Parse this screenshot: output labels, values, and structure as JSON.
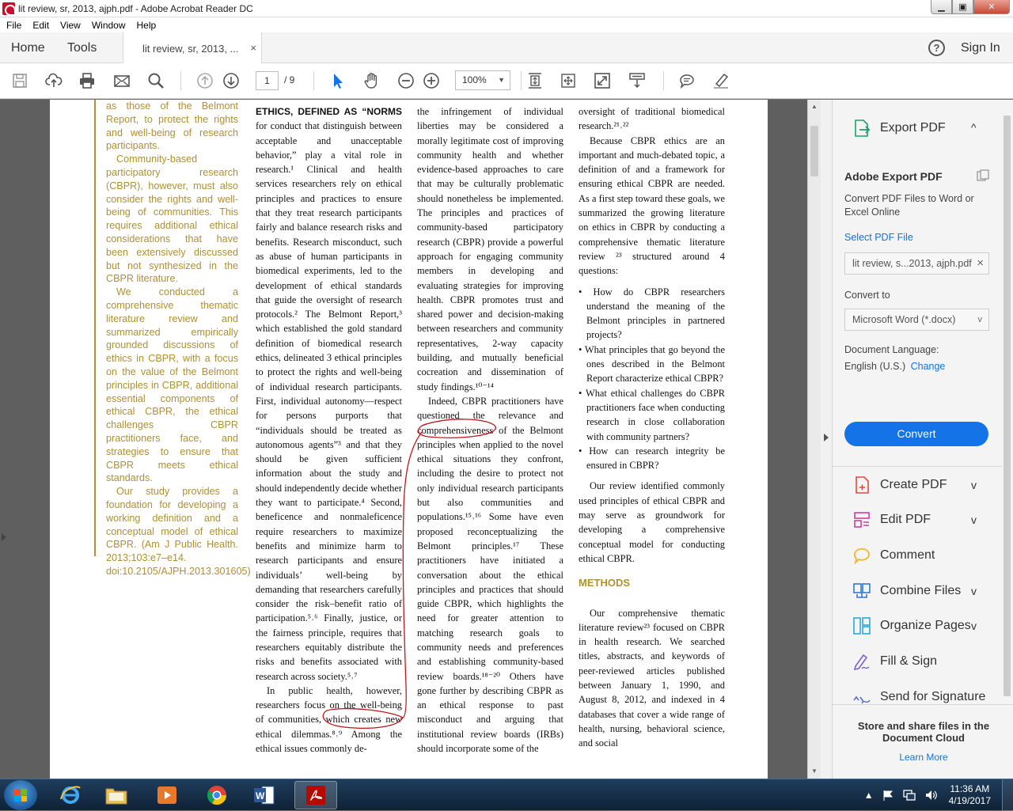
{
  "window": {
    "title": "lit review, sr, 2013, ajph.pdf - Adobe Acrobat Reader DC",
    "min": "▁",
    "max": "▣",
    "close": "✕"
  },
  "menu": [
    "File",
    "Edit",
    "View",
    "Window",
    "Help"
  ],
  "tabs": {
    "home": "Home",
    "tools": "Tools",
    "document": "lit review, sr, 2013, ...",
    "close": "×",
    "help": "?",
    "sign_in": "Sign In"
  },
  "toolbar": {
    "page_current": "1",
    "page_total": "/ 9",
    "zoom": "100%",
    "zoom_caret": "▼",
    "icons": [
      "save-icon",
      "upload-icon",
      "print-icon",
      "email-icon",
      "search-icon",
      "page-up-icon",
      "page-down-icon",
      "select-cursor-icon",
      "hand-icon",
      "zoom-out-icon",
      "zoom-in-icon",
      "fit-page-icon",
      "full-screen-icon",
      "read-mode-icon",
      "scroll-mode-icon",
      "comment-icon",
      "highlight-pen-icon"
    ]
  },
  "document": {
    "abstract": [
      "as those of the Belmont Report, to protect the rights and well-being of research participants.",
      "Community-based participatory research (CBPR), however, must also consider the rights and well-being of communities. This requires additional ethical considerations that have been extensively discussed but not synthesized in the CBPR literature.",
      "We conducted a comprehensive thematic literature review and summarized empirically grounded discussions of ethics in CBPR, with a focus on the value of the Belmont principles in CBPR, additional essential components of ethical CBPR, the ethical challenges CBPR practitioners face, and strategies to ensure that CBPR meets ethical standards.",
      "Our study provides a foundation for developing a working definition and a conceptual model of ethical CBPR. (Am J Public Health. 2013;103:e7–e14. doi:10.2105/AJPH.2013.301605)"
    ],
    "col1": {
      "heading": "ETHICS, DEFINED AS “NORMS",
      "p1": "for conduct that distinguish between acceptable and unacceptable behavior,” play a vital role in research.¹ Clinical and health services researchers rely on ethical principles and practices to ensure that they treat research participants fairly and balance research risks and benefits. Research misconduct, such as abuse of human participants in biomedical experiments, led to the development of ethical standards that guide the oversight of research protocols.² The Belmont Report,³ which established the gold standard definition of biomedical research ethics, delineated 3 ethical principles to protect the rights and well-being of individual research participants. First, individual autonomy—respect for persons purports that “individuals should be treated as autonomous agents”³ and that they should be given sufficient information about the study and should independently decide whether they want to participate.⁴ Second, beneficence and nonmaleficence require researchers to maximize benefits and minimize harm to research participants and ensure individuals’ well-being by demanding that researchers carefully consider the risk–benefit ratio of participation.⁵˒⁶ Finally, justice, or the fairness principle, requires that researchers equitably distribute the risks and benefits associated with research across society.⁵˒⁷",
      "p2": "In public health, however, researchers focus on the well-being of communities, which creates new ethical dilemmas.⁸˒⁹ Among the ethical issues commonly de-"
    },
    "col2": {
      "p1": "the infringement of individual liberties may be considered a morally legitimate cost of improving community health and whether evidence-based approaches to care that may be culturally problematic should nonetheless be implemented. The principles and practices of community-based participatory research (CBPR) provide a powerful approach for engaging community members in developing and evaluating strategies for improving health. CBPR promotes trust and shared power and decision-making between researchers and community representatives, 2-way capacity building, and mutually beneficial cocreation and dissemination of study findings.¹⁰⁻¹⁴",
      "p2": "Indeed, CBPR practitioners have questioned the relevance and comprehensiveness of the Belmont principles when applied to the novel ethical situations they confront, including the desire to protect not only individual research participants but also communities and populations.¹⁵˒¹⁶ Some have even proposed reconceptualizing the Belmont principles.¹⁷ These practitioners have initiated a conversation about the ethical principles and practices that should guide CBPR, which highlights the need for greater attention to matching research goals to community needs and preferences and establishing community-based review boards.¹⁸⁻²⁰ Others have gone further by describing CBPR as an ethical response to past misconduct and arguing that institutional review boards (IRBs) should incorporate some of the"
    },
    "col3": {
      "p0": "oversight of traditional biomedical research.²¹˒²²",
      "p1": "Because CBPR ethics are an important and much-debated topic, a definition of and a framework for ensuring ethical CBPR are needed. As a first step toward these goals, we summarized the growing literature on ethics in CBPR by conducting a comprehensive thematic literature review ²³ structured around 4 questions:",
      "questions": [
        "How do CBPR researchers understand the meaning of the Belmont principles in partnered projects?",
        "What principles that go beyond the ones described in the Belmont Report characterize ethical CBPR?",
        "What ethical challenges do CBPR practitioners face when conducting research in close collaboration with community partners?",
        "How can research integrity be ensured in CBPR?"
      ],
      "p2": "Our review identified commonly used principles of ethical CBPR and may serve as groundwork for developing a comprehensive conceptual model for conducting ethical CBPR.",
      "methods_heading": "METHODS",
      "p3": "Our comprehensive thematic literature review²³ focused on CBPR in health research. We searched titles, abstracts, and keywords of peer-reviewed articles published between January 1, 1990, and August 8, 2012, and indexed in 4 databases that cover a wide range of health, nursing, behavioral science, and social"
    }
  },
  "right_panel": {
    "export_label": "Export PDF",
    "export_chevron": "^",
    "title": "Adobe Export PDF",
    "description": "Convert PDF Files to Word or Excel Online",
    "select_file": "Select PDF File",
    "file_name": "lit review, s...2013, ajph.pdf",
    "file_clear": "×",
    "convert_to": "Convert to",
    "format": "Microsoft Word (*.docx)",
    "format_chevron": "v",
    "doc_language_label": "Document Language:",
    "doc_language": "English (U.S.)",
    "change": "Change",
    "convert_button": "Convert",
    "tools": [
      {
        "label": "Create PDF",
        "chevron": "v"
      },
      {
        "label": "Edit PDF",
        "chevron": "v"
      },
      {
        "label": "Comment",
        "chevron": ""
      },
      {
        "label": "Combine Files",
        "chevron": "v"
      },
      {
        "label": "Organize Pages",
        "chevron": "v"
      },
      {
        "label": "Fill & Sign",
        "chevron": ""
      },
      {
        "label": "Send for Signature",
        "chevron": ""
      }
    ],
    "store": "Store and share files in the Document Cloud",
    "learn_more": "Learn More"
  },
  "taskbar": {
    "time": "11:36 AM",
    "date": "4/19/2017",
    "tray_up": "▲"
  },
  "colors": {
    "accent_blue": "#1473e6",
    "abstract_gold": "#b09030",
    "annotation_red": "#c0151a"
  }
}
